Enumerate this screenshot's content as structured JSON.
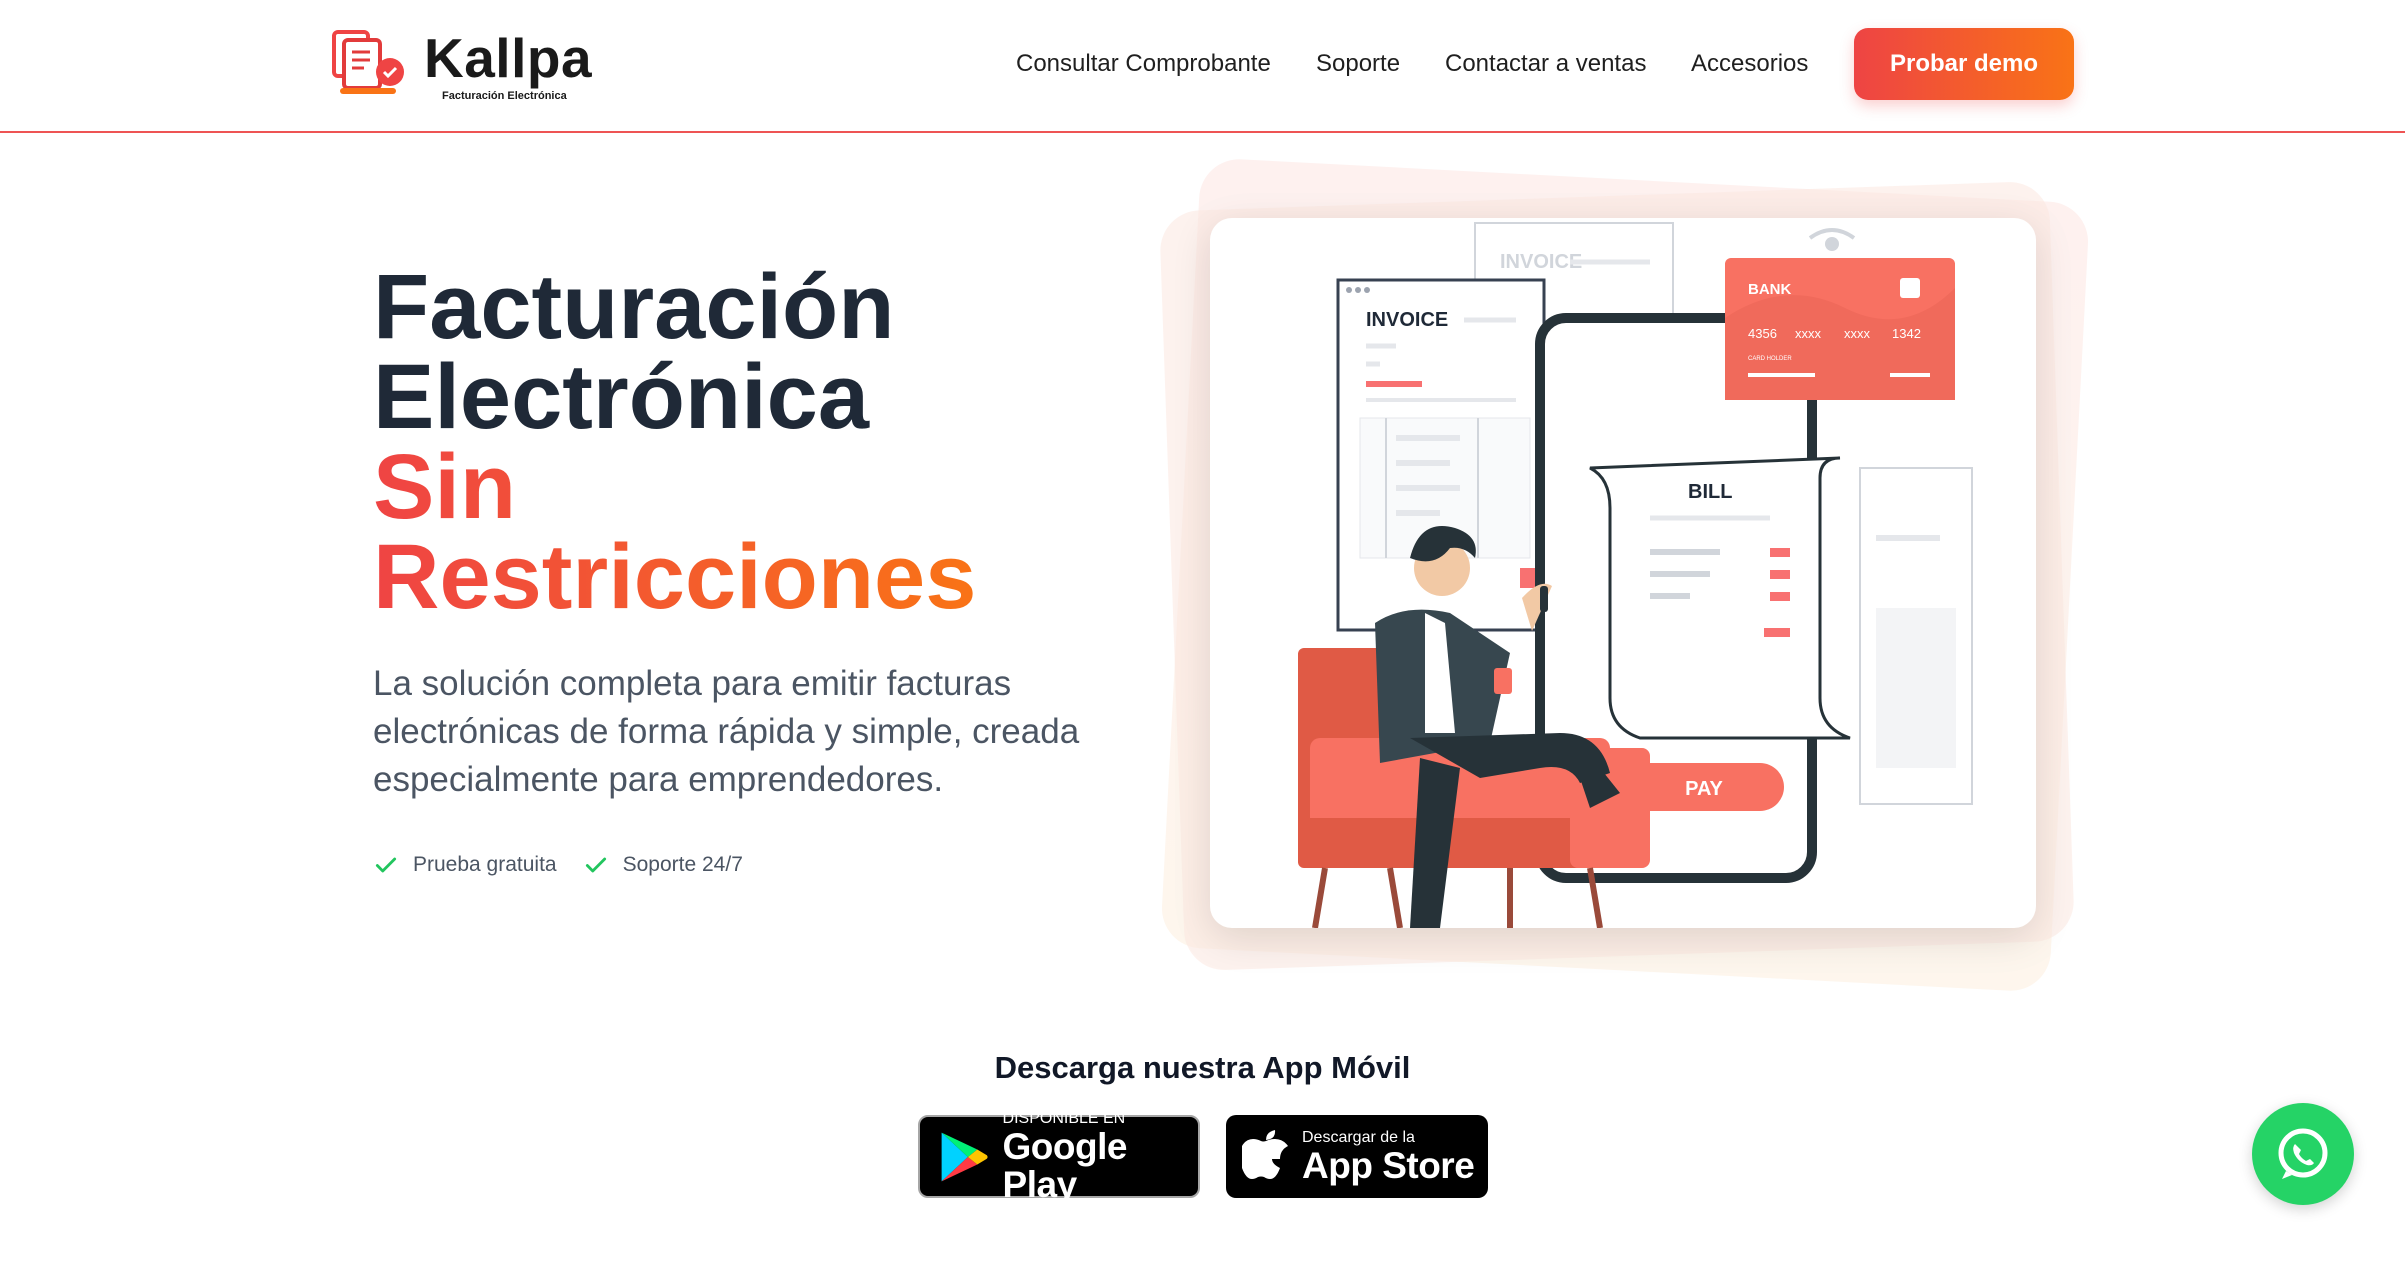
{
  "brand": {
    "name": "Kallpa",
    "tagline": "Facturación Electrónica",
    "logo_icon": "invoice-documents-icon",
    "accent_start": "#ef4444",
    "accent_end": "#f97316"
  },
  "nav": {
    "items": [
      {
        "label": "Consultar Comprobante"
      },
      {
        "label": "Soporte"
      },
      {
        "label": "Contactar a ventas"
      },
      {
        "label": "Accesorios"
      }
    ],
    "cta_label": "Probar demo"
  },
  "hero": {
    "title_line1": "Facturación",
    "title_line2": "Electrónica",
    "title_line3": "Sin",
    "title_line4": "Restricciones",
    "lead": "La solución completa para emitir facturas electrónicas de forma rápida y simple, creada especialmente para emprendedores.",
    "features": [
      {
        "label": "Prueba gratuita",
        "icon": "check-icon"
      },
      {
        "label": "Soporte 24/7",
        "icon": "check-icon"
      }
    ]
  },
  "illustration": {
    "invoice_label": "INVOICE",
    "invoice_label_back": "INVOICE",
    "bank_label": "BANK",
    "card_number": [
      "4356",
      "xxxx",
      "xxxx",
      "1342"
    ],
    "card_holder": "CARD HOLDER",
    "bill_label": "BILL",
    "pay_label": "PAY"
  },
  "apps": {
    "title": "Descarga nuestra App Móvil",
    "google_small": "DISPONIBLE EN",
    "google_big": "Google Play",
    "apple_small": "Descargar de la",
    "apple_big": "App Store"
  },
  "whatsapp": {
    "icon": "whatsapp-icon",
    "color": "#25d366"
  }
}
